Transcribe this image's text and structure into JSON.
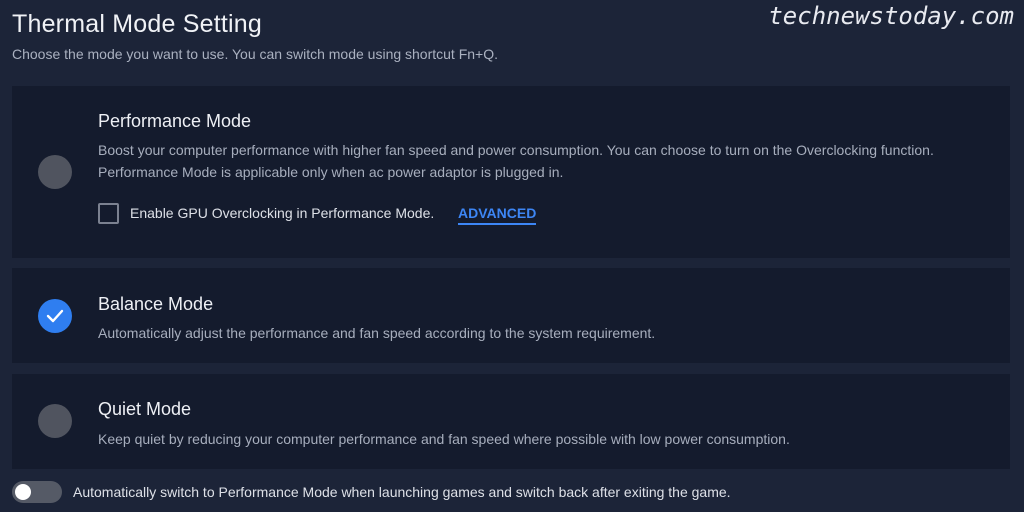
{
  "header": {
    "title": "Thermal Mode Setting",
    "subtitle": "Choose the mode you want to use. You can switch mode using shortcut Fn+Q."
  },
  "watermark": "technewstoday.com",
  "modes": [
    {
      "name": "Performance Mode",
      "description": "Boost your computer performance with higher fan speed and power consumption. You can choose to turn on the Overclocking function. Performance Mode is applicable only when ac power adaptor is plugged in.",
      "selected": false,
      "overclock_label": "Enable GPU Overclocking in Performance Mode.",
      "overclock_checked": false,
      "advanced_link": "ADVANCED"
    },
    {
      "name": "Balance Mode",
      "description": "Automatically adjust the performance and fan speed according to the system requirement.",
      "selected": true
    },
    {
      "name": "Quiet Mode",
      "description": "Keep quiet by reducing your computer performance and fan speed where possible with low power consumption.",
      "selected": false
    }
  ],
  "auto_switch": {
    "label": "Automatically switch to Performance Mode when launching games and switch back after exiting the game.",
    "enabled": false
  },
  "colors": {
    "background": "#1c2438",
    "card": "#141b2d",
    "accent": "#2f7ef0",
    "link": "#3d86f5"
  }
}
